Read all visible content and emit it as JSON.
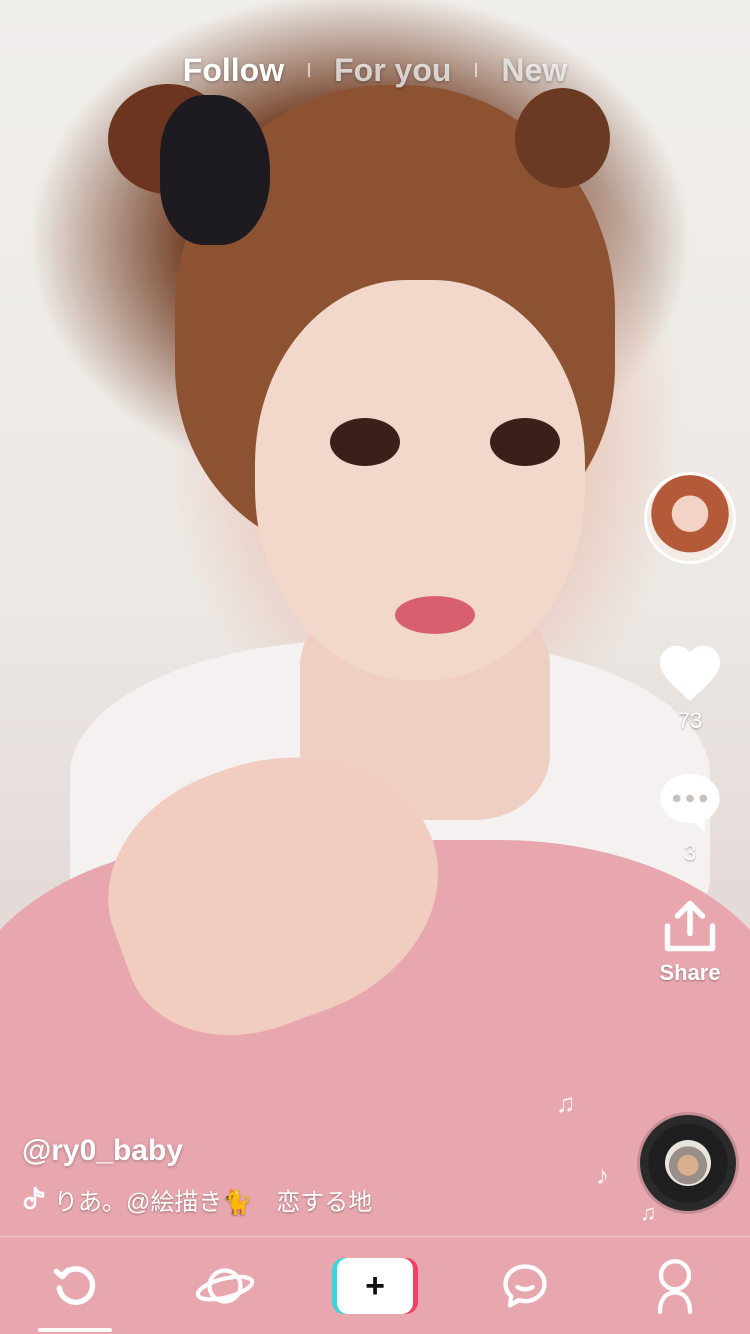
{
  "tabs": [
    {
      "label": "Follow",
      "active": true
    },
    {
      "label": "For you",
      "active": false
    },
    {
      "label": "New",
      "active": false
    }
  ],
  "rail": {
    "likes": "73",
    "comments": "3",
    "share_label": "Share"
  },
  "caption": {
    "username": "@ry0_baby",
    "music_text": "りあ。@絵描き🐈　恋する地"
  },
  "icons": {
    "heart": "heart-icon",
    "comment": "comment-icon",
    "share": "share-icon",
    "music_note": "music-note-icon",
    "home": "refresh-home-icon",
    "discover": "planet-icon",
    "create": "plus-icon",
    "inbox": "message-icon",
    "profile": "profile-icon"
  },
  "colors": {
    "accent_cyan": "#39d6dc",
    "accent_red": "#f43e63",
    "text": "#ffffff"
  },
  "nav": {
    "create_symbol": "+"
  }
}
